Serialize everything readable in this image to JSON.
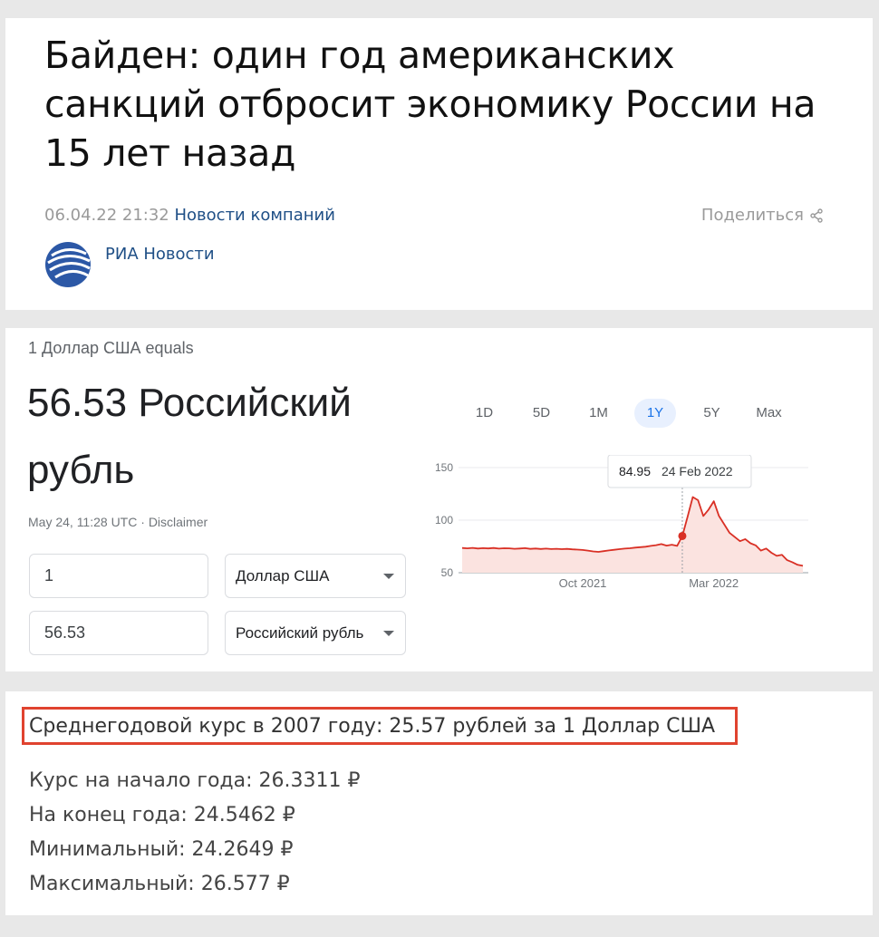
{
  "article": {
    "headline": "Байден: один год американских санкций отбросит экономику России на 15 лет назад",
    "datetime": "06.04.22 21:32",
    "category": "Новости компаний",
    "share_label": "Поделиться",
    "source": "РИА Новости",
    "colors": {
      "link": "#1f4f86",
      "muted": "#9a9a9a"
    }
  },
  "converter": {
    "equals_label": "1 Доллар США equals",
    "result": "56.53 Российский рубль",
    "timestamp": "May 24, 11:28 UTC",
    "separator": "·",
    "disclaimer": "Disclaimer",
    "amount_from": "1",
    "currency_from": "Доллар США",
    "amount_to": "56.53",
    "currency_to": "Российский рубль",
    "tabs": [
      "1D",
      "5D",
      "1M",
      "1Y",
      "5Y",
      "Max"
    ],
    "active_tab": "1Y",
    "tooltip": {
      "value": "84.95",
      "date": "24 Feb 2022"
    }
  },
  "chart_data": {
    "type": "area",
    "y_ticks": [
      150,
      100,
      50
    ],
    "x_ticks": [
      "Oct 2021",
      "Mar 2022"
    ],
    "ylim": [
      50,
      150
    ],
    "grid": true,
    "color": "#d93025",
    "fill": "#fbe3e0",
    "highlight": {
      "date": "24 Feb 2022",
      "value": 84.95
    },
    "series": [
      {
        "values": [
          73.5,
          73.2,
          73.6,
          73.0,
          73.4,
          73.1,
          73.5,
          72.9,
          73.3,
          73.2,
          72.8,
          73.0,
          73.4,
          72.7,
          73.0,
          72.6,
          72.9,
          72.5,
          72.8,
          72.4,
          72.7,
          72.2,
          72.0,
          71.6,
          71.0,
          70.3,
          69.8,
          70.5,
          71.2,
          71.8,
          72.4,
          72.9,
          73.3,
          73.9,
          74.3,
          74.7,
          75.5,
          76.2,
          77.2,
          75.8,
          76.6,
          75.5,
          84.95,
          103.0,
          122.0,
          119.0,
          104.0,
          110.0,
          118.0,
          104.0,
          96.0,
          88.0,
          84.0,
          80.0,
          82.0,
          78.0,
          76.0,
          71.0,
          73.0,
          69.0,
          66.0,
          67.0,
          62.0,
          60.0,
          57.5,
          56.53
        ]
      }
    ]
  },
  "stats": {
    "average": "Среднегодовой курс в 2007 году: 25.57 рублей за 1 Доллар США",
    "start": "Курс на начало года: 26.3311 ₽",
    "end": "На конец года: 24.5462 ₽",
    "min": "Минимальный: 24.2649 ₽",
    "max": "Максимальный: 26.577 ₽",
    "highlight_color": "#e0432f"
  }
}
